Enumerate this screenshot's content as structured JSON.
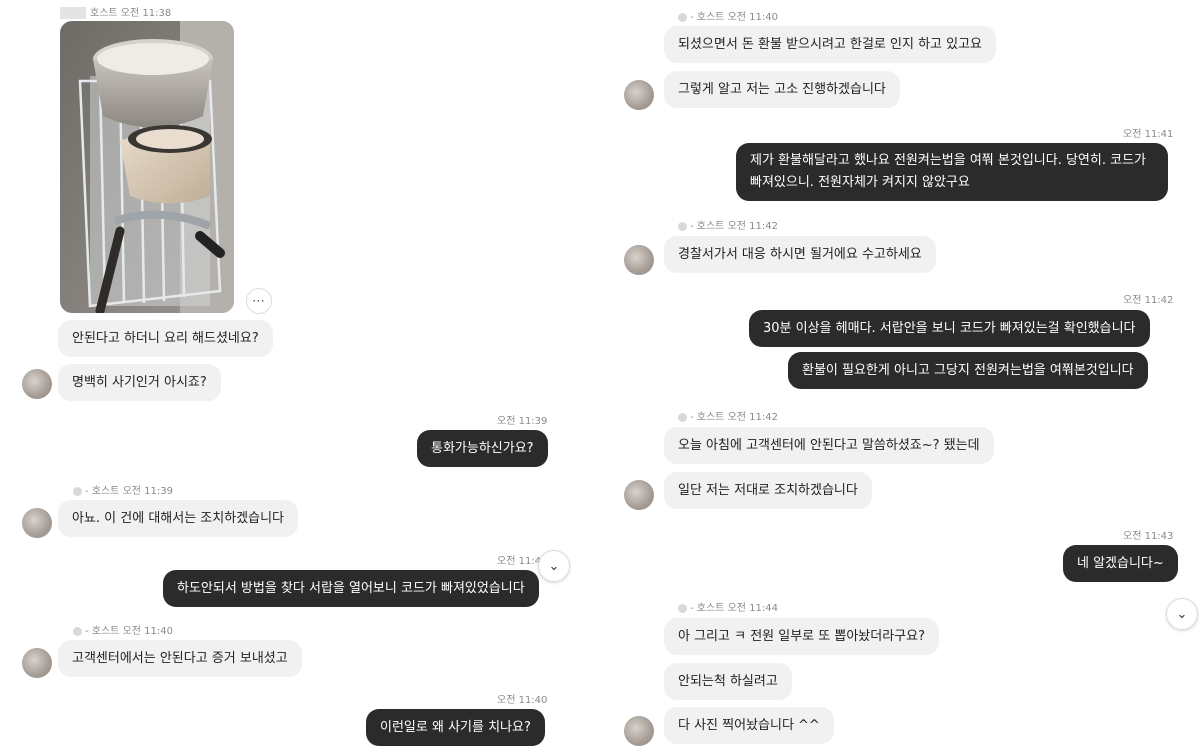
{
  "left": {
    "header": {
      "sender": "호스트",
      "time": "오전 11:38"
    },
    "messages": [
      {
        "text": "안된다고 하더니 요리 해드셨네요?"
      },
      {
        "text": "명백히 사기인거 아시죠?"
      },
      {
        "time": "오전 11:39",
        "text": "통화가능하신가요?"
      },
      {
        "sender": "- 호스트",
        "time": "오전 11:39",
        "text": "아뇨. 이 건에 대해서는 조치하겠습니다"
      },
      {
        "time": "오전 11:40",
        "text": "하도안되서 방법을 찾다 서랍을 열어보니 코드가 빠져있었습니다"
      },
      {
        "sender": "- 호스트",
        "time": "오전 11:40",
        "text": "고객센터에서는 안된다고 증거 보내셨고"
      },
      {
        "time": "오전 11:40",
        "text": "이런일로 왜 사기를 치나요?"
      }
    ]
  },
  "right": {
    "messages": [
      {
        "sender": "- 호스트",
        "time": "오전 11:40",
        "text": "되셨으면서 돈 환불 받으시려고 한걸로 인지 하고 있고요"
      },
      {
        "text": "그렇게 알고 저는 고소 진행하겠습니다"
      },
      {
        "time": "오전 11:41",
        "text": "제가 환불해달라고 했나요 전원켜는법을 여쭤 본것입니다. 당연히. 코드가 빠져있으니. 전원자체가 켜지지 않았구요"
      },
      {
        "sender": "- 호스트",
        "time": "오전 11:42",
        "text": "경찰서가서 대응 하시면 될거에요 수고하세요"
      },
      {
        "time": "오전 11:42",
        "text": "30분 이상을 헤매다. 서랍안을 보니 코드가 빠져있는걸 확인했습니다"
      },
      {
        "text": "환불이 필요한게 아니고 그당지 전원켜는법을 여쭤본것입니다"
      },
      {
        "sender": "- 호스트",
        "time": "오전 11:42",
        "text": "오늘 아침에 고객센터에 안된다고 말씀하셨죠~? 됐는데"
      },
      {
        "text": "일단 저는 저대로 조치하겠습니다"
      },
      {
        "time": "오전 11:43",
        "text": "네 알겠습니다~"
      },
      {
        "sender": "- 호스트",
        "time": "오전 11:44",
        "text": "아 그리고 ㅋ 전원 일부로 또 뽑아놨더라구요?"
      },
      {
        "text": "안되는척 하실려고"
      },
      {
        "text": "다 사진 찍어놨습니다 ^^"
      }
    ]
  },
  "icons": {
    "more": "⋯",
    "scroll_down": "⌄"
  }
}
